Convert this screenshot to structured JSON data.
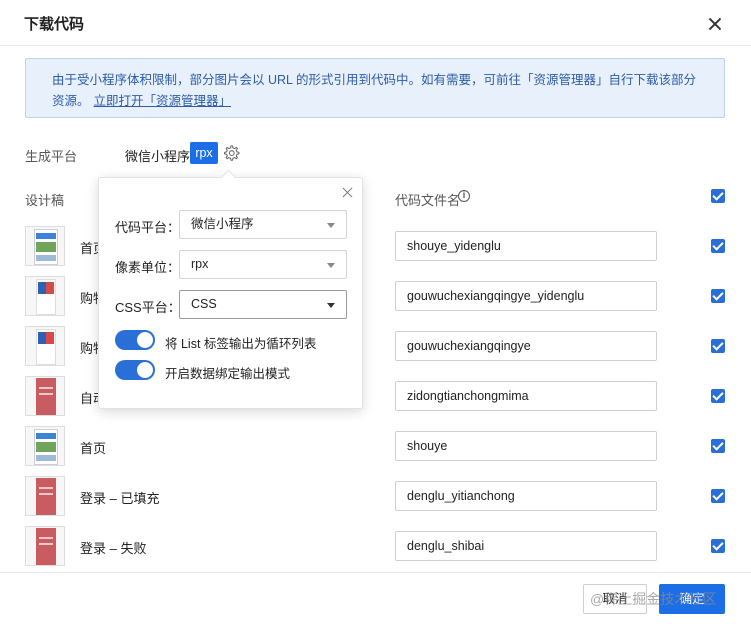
{
  "dialog": {
    "title": "下载代码",
    "close_icon": "close-icon"
  },
  "notice": {
    "text": "由于受小程序体积限制，部分图片会以 URL 的形式引用到代码中。如有需要，可前往「资源管理器」自行下载该部分资源。",
    "link": "立即打开「资源管理器」"
  },
  "platform": {
    "label": "生成平台",
    "value": "微信小程序",
    "unit_tag": "rpx",
    "settings_icon": "gear-icon"
  },
  "table": {
    "design_header": "设计稿",
    "filename_header": "代码文件名",
    "info_icon": "info-icon",
    "select_all_checked": true,
    "rows": [
      {
        "name": "首页 - 一键登录",
        "filename": "shouye_yidenglu",
        "thumb": "home",
        "checked": true
      },
      {
        "name": "购物车 - 一键登录",
        "filename": "gouwuchexiangqingye_yidenglu",
        "thumb": "cart",
        "checked": true
      },
      {
        "name": "购物车详情页",
        "filename": "gouwuchexiangqingye",
        "thumb": "cart",
        "checked": true
      },
      {
        "name": "自动填充密码",
        "filename": "zidongtianchongmima",
        "thumb": "login",
        "checked": true
      },
      {
        "name": "首页",
        "filename": "shouye",
        "thumb": "home",
        "checked": true
      },
      {
        "name": "登录 – 已填充",
        "filename": "denglu_yitianchong",
        "thumb": "login",
        "checked": true
      },
      {
        "name": "登录 – 失败",
        "filename": "denglu_shibai",
        "thumb": "login",
        "checked": true
      }
    ]
  },
  "popover": {
    "close_icon": "close-icon",
    "code_platform_label": "代码平台：",
    "code_platform_value": "微信小程序",
    "pixel_unit_label": "像素单位：",
    "pixel_unit_value": "rpx",
    "css_platform_label": "CSS平台：",
    "css_platform_value": "CSS",
    "toggle_list_label": "将 List 标签输出为循环列表",
    "toggle_list_on": true,
    "toggle_binding_label": "开启数据绑定输出模式",
    "toggle_binding_on": true
  },
  "footer": {
    "cancel_label": "取消",
    "ok_label": "确定",
    "watermark": "@稀土掘金技术社区"
  },
  "colors": {
    "accent": "#1b6ee6",
    "notice_bg": "#e8f0fb",
    "notice_text": "#2c5ca8"
  }
}
